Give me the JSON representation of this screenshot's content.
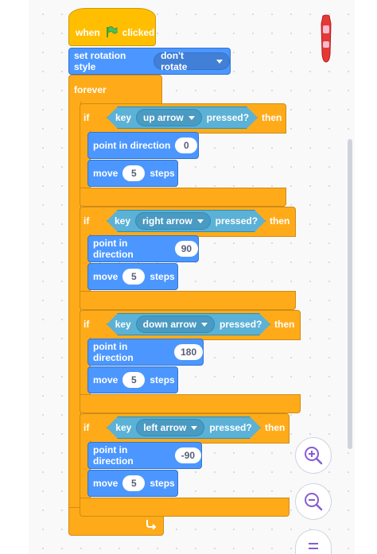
{
  "hat": {
    "when": "when",
    "clicked": "clicked"
  },
  "rotation": {
    "label": "set rotation style",
    "value": "don't rotate"
  },
  "forever": {
    "label": "forever"
  },
  "if_blocks": [
    {
      "if": "if",
      "key": "key",
      "key_value": "up arrow",
      "pressed": "pressed?",
      "then": "then",
      "direction_label": "point in direction",
      "direction": "0",
      "move": "move",
      "steps_value": "5",
      "steps": "steps"
    },
    {
      "if": "if",
      "key": "key",
      "key_value": "right arrow",
      "pressed": "pressed?",
      "then": "then",
      "direction_label": "point in direction",
      "direction": "90",
      "move": "move",
      "steps_value": "5",
      "steps": "steps"
    },
    {
      "if": "if",
      "key": "key",
      "key_value": "down arrow",
      "pressed": "pressed?",
      "then": "then",
      "direction_label": "point in direction",
      "direction": "180",
      "move": "move",
      "steps_value": "5",
      "steps": "steps"
    },
    {
      "if": "if",
      "key": "key",
      "key_value": "left arrow",
      "pressed": "pressed?",
      "then": "then",
      "direction_label": "point in direction",
      "direction": "-90",
      "move": "move",
      "steps_value": "5",
      "steps": "steps"
    }
  ],
  "controls": {
    "zoom_in": "zoom-in-icon",
    "zoom_out": "zoom-out-icon",
    "reset": "equals-icon"
  },
  "colors": {
    "events": "#ffbf00",
    "control": "#ffab19",
    "motion": "#4c97ff",
    "sensing": "#5cb1d6"
  }
}
